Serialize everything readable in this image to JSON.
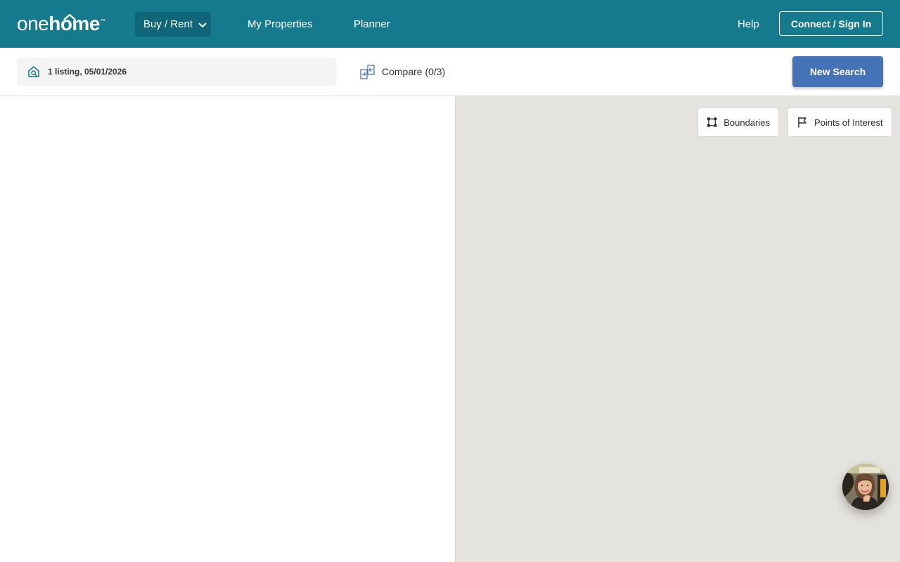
{
  "brand": {
    "logo_one": "one",
    "logo_home": "home",
    "logo_tm": "™"
  },
  "nav": {
    "buy_rent": "Buy / Rent",
    "my_properties": "My Properties",
    "planner": "Planner",
    "help": "Help",
    "sign_in": "Connect / Sign In"
  },
  "toolbar": {
    "search_summary": "1 listing, 05/01/2026",
    "compare": "Compare (0/3)",
    "new_search": "New Search"
  },
  "map": {
    "boundaries": "Boundaries",
    "points_of_interest": "Points of Interest"
  },
  "icons": {
    "search_pill": "home-search-icon",
    "compare": "compare-icon",
    "buy_rent": "chevron-down-icon",
    "boundaries": "boundary-square-icon",
    "poi": "flag-icon",
    "chat": "agent-avatar"
  },
  "colors": {
    "header_bg": "#157a8e",
    "active_nav_bg": "#0f6678",
    "primary_button": "#4673b8",
    "map_bg": "#e5e3df",
    "search_pill_bg": "#f4f4f4"
  }
}
